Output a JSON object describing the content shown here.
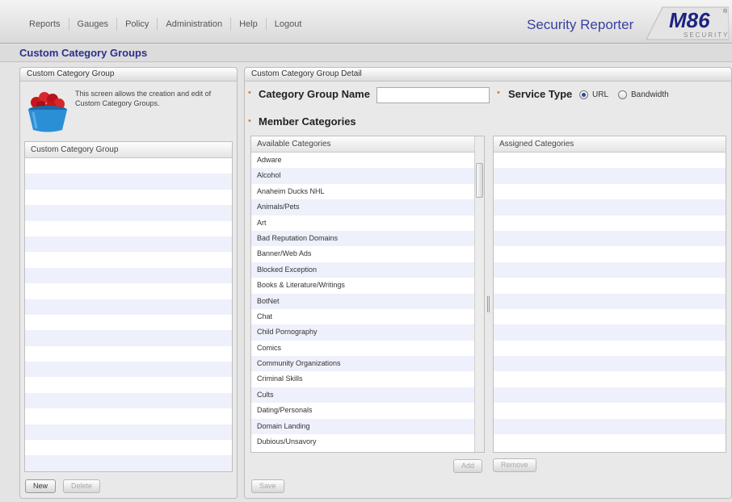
{
  "nav": {
    "items": [
      "Reports",
      "Gauges",
      "Policy",
      "Administration",
      "Help",
      "Logout"
    ],
    "brand_title": "Security Reporter",
    "logo_text": "M86",
    "logo_subtext": "SECURITY",
    "registered_mark": "®"
  },
  "page": {
    "title": "Custom Category Groups"
  },
  "left_panel": {
    "header": "Custom Category Group",
    "intro": "This screen allows the creation and edit of Custom Category Groups.",
    "list_header": "Custom Category Group",
    "rows": [
      "",
      "",
      "",
      "",
      "",
      "",
      "",
      "",
      "",
      "",
      "",
      "",
      "",
      "",
      "",
      "",
      "",
      "",
      "",
      "",
      ""
    ],
    "new_label": "New",
    "delete_label": "Delete"
  },
  "right_panel": {
    "header": "Custom Category Group Detail",
    "group_name_label": "Category Group Name",
    "group_name_value": "",
    "service_type_label": "Service Type",
    "service_options": [
      {
        "label": "URL",
        "checked": true
      },
      {
        "label": "Bandwidth",
        "checked": false
      }
    ],
    "members_label": "Member Categories",
    "available_header": "Available Categories",
    "available": [
      "Adware",
      "Alcohol",
      "Anaheim Ducks NHL",
      "Animals/Pets",
      "Art",
      "Bad Reputation Domains",
      "Banner/Web Ads",
      "Blocked Exception",
      "Books & Literature/Writings",
      "BotNet",
      "Chat",
      "Child Pornography",
      "Comics",
      "Community Organizations",
      "Criminal Skills",
      "Cults",
      "Dating/Personals",
      "Domain Landing",
      "Dubious/Unsavory"
    ],
    "assigned_header": "Assigned Categories",
    "assigned": [
      "",
      "",
      "",
      "",
      "",
      "",
      "",
      "",
      "",
      "",
      "",
      "",
      "",
      "",
      "",
      "",
      "",
      "",
      ""
    ],
    "add_label": "Add",
    "remove_label": "Remove",
    "save_label": "Save"
  },
  "colors": {
    "brand": "#3b3ea0",
    "title": "#2c2f8f",
    "required_marker": "#e07a2b",
    "row_alt": "#eef0fb"
  }
}
